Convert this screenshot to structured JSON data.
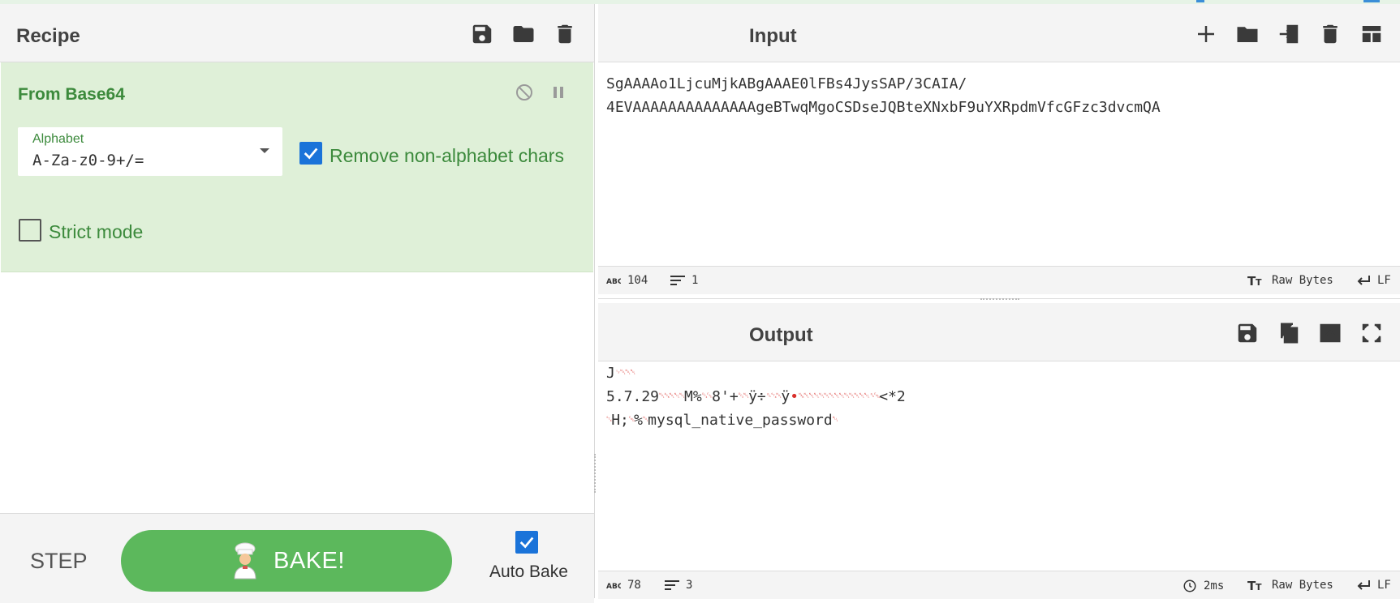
{
  "recipe": {
    "title": "Recipe",
    "icons": [
      "save-icon",
      "folder-icon",
      "trash-icon"
    ],
    "operation": {
      "name": "From Base64",
      "alphabet_label": "Alphabet",
      "alphabet_value": "A-Za-z0-9+/=",
      "remove_non_alphabet_label": "Remove non-alphabet chars",
      "remove_non_alphabet_checked": true,
      "strict_mode_label": "Strict mode",
      "strict_mode_checked": false
    },
    "step_label": "STEP",
    "bake_label": "BAKE!",
    "auto_bake_label": "Auto Bake",
    "auto_bake_checked": true
  },
  "input": {
    "title": "Input",
    "icons": [
      "plus-icon",
      "folder-icon",
      "file-import-icon",
      "trash-icon",
      "layout-icon"
    ],
    "lines": [
      "SgAAAAo1LjcuMjkABgAAAE0lFBs4JysSAP/3CAIA/",
      "4EVAAAAAAAAAAAAAAgeBTwqMgoCSDseJQBteXNxbF9uYXRpdmVfcGFzc3dvcmQA"
    ],
    "status": {
      "length": "104",
      "lines": "1",
      "encoding": "Raw Bytes",
      "eol": "LF"
    }
  },
  "output": {
    "title": "Output",
    "icons": [
      "save-icon",
      "copy-icon",
      "replace-input-icon",
      "maximize-icon"
    ],
    "line1_a": "J",
    "line2_a": "5.7.29",
    "line2_b": "M%",
    "line2_c": "8'+",
    "line2_d": "ÿ÷",
    "line2_e": "ÿ",
    "line2_f": "<*2",
    "line3_a": "H;",
    "line3_b": "%",
    "line3_c": "mysql_native_password",
    "status": {
      "length": "78",
      "lines": "3",
      "time": "2ms",
      "encoding": "Raw Bytes",
      "eol": "LF"
    }
  }
}
